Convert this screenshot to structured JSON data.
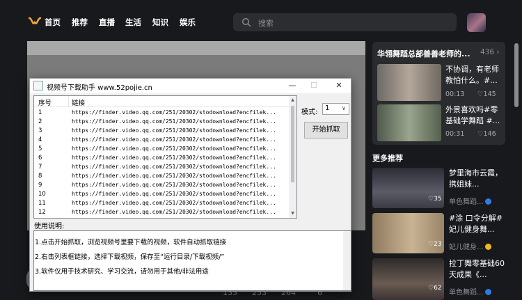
{
  "nav": {
    "items": [
      "首页",
      "推荐",
      "直播",
      "生活",
      "知识",
      "娱乐"
    ],
    "search_placeholder": "搜索"
  },
  "video_stats": [
    "135",
    "253",
    "264",
    "6"
  ],
  "collection": {
    "title": "华翎舞蹈总部善善老师的...",
    "count": "436",
    "videos": [
      {
        "title": "不协调，有老师教怕什么。#...",
        "duration": "00:13",
        "likes": "145"
      },
      {
        "title": "外景喜欢吗#零基础学舞蹈 #...",
        "duration": "00:31",
        "likes": "146"
      }
    ]
  },
  "more": {
    "title": "更多推荐",
    "items": [
      {
        "title": "梦里海市云霞，携姐妹...",
        "author": "单色舞蹈...",
        "likes": "35"
      },
      {
        "title": "#涂 口令分解#妃儿健身舞...",
        "author": "妃儿健身...",
        "likes": "23"
      },
      {
        "title": "拉丁舞零基础60天成果《...",
        "author": "单色舞蹈...",
        "likes": "62"
      }
    ]
  },
  "dialog": {
    "title": "视频号下载助手  www.52pojie.cn",
    "btn_min": "—",
    "btn_max": "☐",
    "btn_close": "✕",
    "columns": [
      "序号",
      "链接"
    ],
    "rows": [
      {
        "no": "1",
        "url": "https://finder.video.qq.com/251/20302/stodownload?encfilek..."
      },
      {
        "no": "2",
        "url": "https://finder.video.qq.com/251/20302/stodownload?encfilek..."
      },
      {
        "no": "3",
        "url": "https://finder.video.qq.com/251/20302/stodownload?encfilek..."
      },
      {
        "no": "4",
        "url": "https://finder.video.qq.com/251/20302/stodownload?encfilek..."
      },
      {
        "no": "5",
        "url": "https://finder.video.qq.com/251/20302/stodownload?encfilek..."
      },
      {
        "no": "6",
        "url": "https://finder.video.qq.com/251/20302/stodownload?encfilek..."
      },
      {
        "no": "7",
        "url": "https://finder.video.qq.com/251/20302/stodownload?encfilek..."
      },
      {
        "no": "8",
        "url": "https://finder.video.qq.com/251/20302/stodownload?encfilek..."
      },
      {
        "no": "9",
        "url": "https://finder.video.qq.com/251/20302/stodownload?encfilek..."
      },
      {
        "no": "10",
        "url": "https://finder.video.qq.com/251/20302/stodownload?encfilek..."
      },
      {
        "no": "11",
        "url": "https://finder.video.qq.com/251/20302/stodownload?encfilek..."
      },
      {
        "no": "12",
        "url": "https://finder.video.qq.com/251/20302/stodownload?encfilek..."
      }
    ],
    "mode_label": "模式:",
    "mode_value": "1",
    "start_button": "开始抓取",
    "usage_label": "使用说明:",
    "usage_lines": [
      "1.点击开始抓取，浏览视频号里要下载的视频，软件自动抓取链接",
      "2.右击列表框链接，选择下载视频，保存至“运行目录/下载视频/”",
      "3.软件仅用于技术研究、学习交流，请勿用于其他/非法用途"
    ]
  }
}
